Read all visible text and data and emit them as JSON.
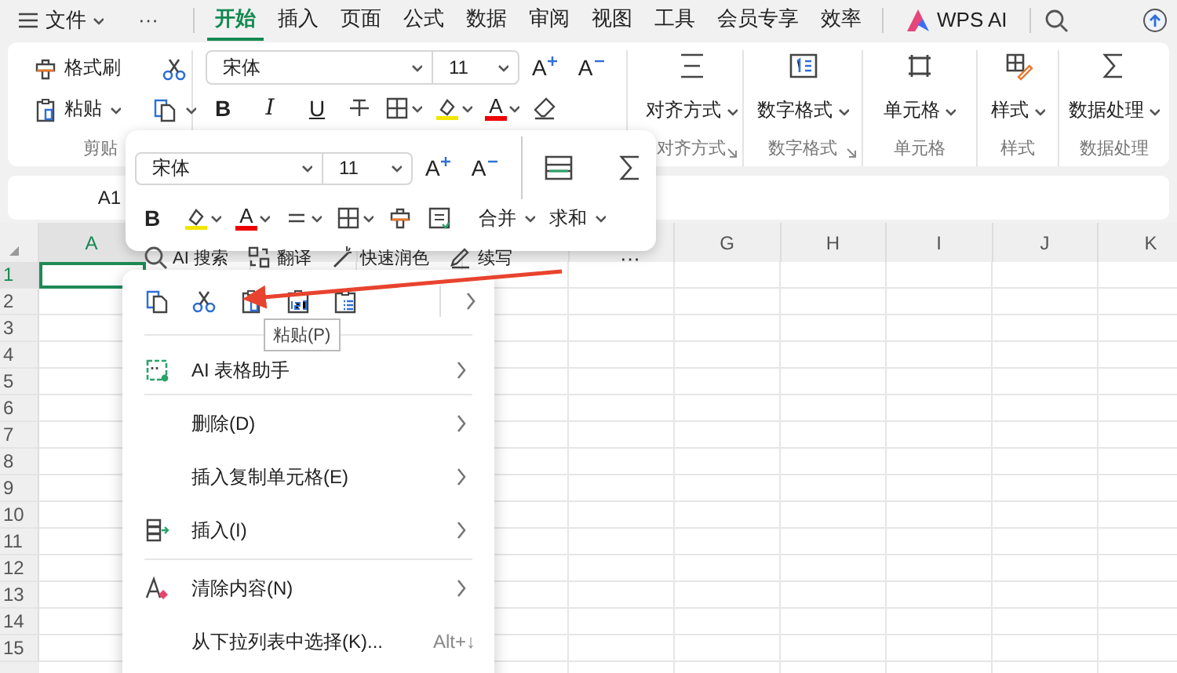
{
  "menu_bar": {
    "file": "文件",
    "more": "···",
    "tabs": [
      {
        "label": "开始",
        "selected": true
      },
      {
        "label": "插入",
        "selected": false
      },
      {
        "label": "页面",
        "selected": false
      },
      {
        "label": "公式",
        "selected": false
      },
      {
        "label": "数据",
        "selected": false
      },
      {
        "label": "审阅",
        "selected": false
      },
      {
        "label": "视图",
        "selected": false
      },
      {
        "label": "工具",
        "selected": false
      },
      {
        "label": "会员专享",
        "selected": false
      },
      {
        "label": "效率",
        "selected": false
      }
    ],
    "ai": "WPS AI"
  },
  "ribbon": {
    "clipboard": {
      "format_painter": "格式刷",
      "paste": "粘贴",
      "label": "剪贴"
    },
    "font": {
      "name": "宋体",
      "size": "11",
      "grow": "A",
      "shrink": "A",
      "styles": [
        "B",
        "I",
        "U"
      ],
      "font_color": "A"
    },
    "groups": [
      {
        "kind": "align",
        "button": "对齐方式",
        "label": "对齐方式",
        "launcher": true
      },
      {
        "kind": "number",
        "button": "数字格式",
        "label": "数字格式",
        "launcher": true
      },
      {
        "kind": "cell",
        "button": "单元格",
        "label": "单元格",
        "launcher": false
      },
      {
        "kind": "style",
        "button": "样式",
        "label": "样式",
        "launcher": false
      },
      {
        "kind": "sum",
        "button": "数据处理",
        "label": "数据处理",
        "launcher": false
      }
    ]
  },
  "formula_bar": {
    "name_box": "A1"
  },
  "sheet": {
    "columns": [
      {
        "label": "A",
        "selected": true
      },
      {},
      {},
      {},
      {},
      {},
      {
        "label": "G",
        "selected": false
      },
      {
        "label": "H",
        "selected": false
      },
      {
        "label": "I",
        "selected": false
      },
      {
        "label": "J",
        "selected": false
      },
      {
        "label": "K",
        "selected": false
      }
    ],
    "rows": [
      {
        "label": "1",
        "selected": true
      },
      {
        "label": "2",
        "selected": false
      },
      {
        "label": "3",
        "selected": false
      },
      {
        "label": "4",
        "selected": false
      },
      {
        "label": "5",
        "selected": false
      },
      {
        "label": "6",
        "selected": false
      },
      {
        "label": "7",
        "selected": false
      },
      {
        "label": "8",
        "selected": false
      },
      {
        "label": "9",
        "selected": false
      },
      {
        "label": "10",
        "selected": false
      },
      {
        "label": "11",
        "selected": false
      },
      {
        "label": "12",
        "selected": false
      },
      {
        "label": "13",
        "selected": false
      },
      {
        "label": "14",
        "selected": false
      },
      {
        "label": "15",
        "selected": false
      }
    ]
  },
  "mini_toolbar": {
    "font": "宋体",
    "size": "11",
    "grow": "A",
    "shrink": "A",
    "bold": "B",
    "font_color": "A",
    "merge": "合并",
    "sum": "求和",
    "actions": [
      {
        "kind": "search",
        "label": "AI 搜索"
      },
      {
        "kind": "translate",
        "label": "翻译"
      },
      {
        "kind": "polish",
        "label": "快速润色"
      },
      {
        "kind": "write",
        "label": "续写"
      }
    ],
    "more": "···"
  },
  "context_menu": {
    "items": [
      {
        "kind": "ai",
        "label": "AI 表格助手",
        "separator_before": true,
        "submenu": true
      },
      {
        "kind": "plain",
        "label": "删除(D)",
        "separator_before": true,
        "submenu": true
      },
      {
        "kind": "plain",
        "label": "插入复制单元格(E)",
        "separator_before": false,
        "submenu": true
      },
      {
        "kind": "insert",
        "label": "插入(I)",
        "separator_before": false,
        "submenu": true
      },
      {
        "kind": "clear",
        "label": "清除内容(N)",
        "separator_before": true,
        "submenu": true
      },
      {
        "kind": "plain",
        "label": "从下拉列表中选择(K)...",
        "separator_before": false,
        "submenu": false,
        "shortcut": "Alt+↓"
      }
    ]
  },
  "tooltip": "粘贴(P)"
}
